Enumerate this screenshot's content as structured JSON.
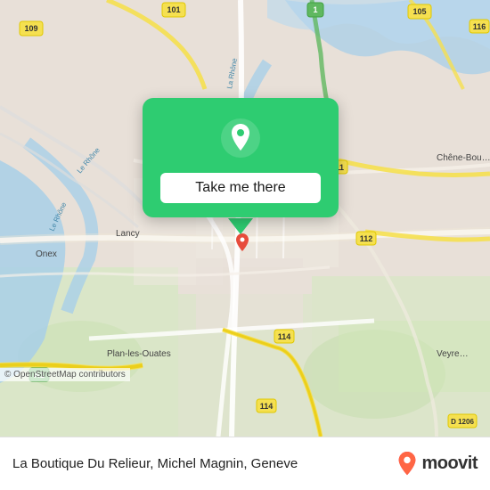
{
  "map": {
    "attribution": "© OpenStreetMap contributors"
  },
  "popup": {
    "button_label": "Take me there",
    "location_icon": "location-pin-icon"
  },
  "bottom_bar": {
    "place_name": "La Boutique Du Relieur, Michel Magnin, Geneve",
    "moovit_text": "moovit"
  },
  "colors": {
    "popup_green": "#2ecc71",
    "button_bg": "#ffffff",
    "pin_red": "#e74c3c",
    "road_color": "#ffffff",
    "water_color": "#a8cfe8",
    "park_color": "#c8e6c0",
    "map_bg": "#e8e0d8"
  }
}
